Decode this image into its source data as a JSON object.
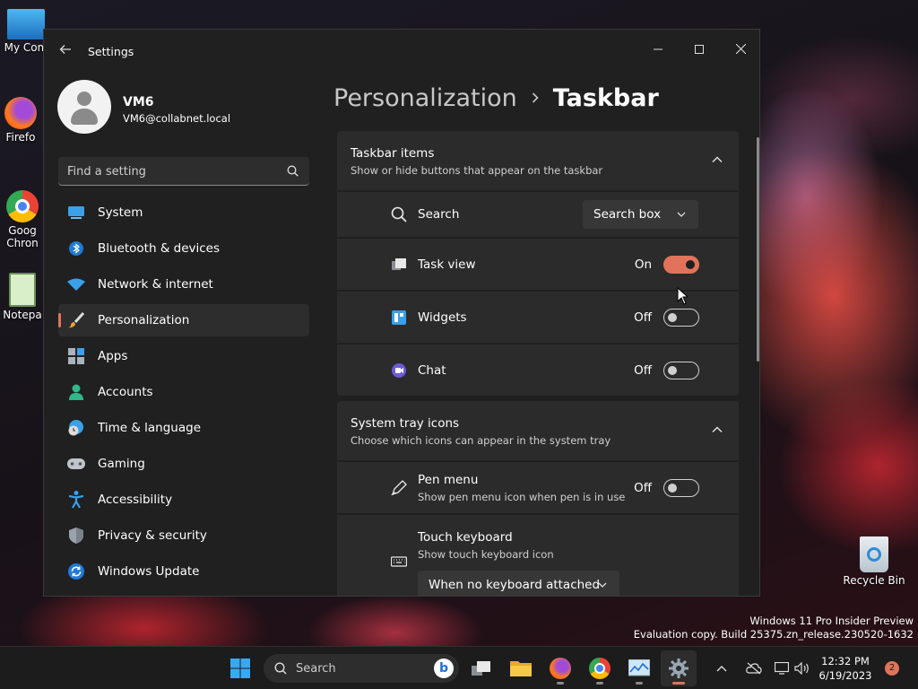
{
  "desktop": {
    "icons": [
      {
        "label": "My Com",
        "icon": "computer-icon"
      },
      {
        "label": "Firefo",
        "icon": "firefox-icon"
      },
      {
        "label": "Goog Chron",
        "icon": "chrome-icon"
      },
      {
        "label": "Notepa",
        "icon": "notepad-icon"
      },
      {
        "label": "Recycle Bin",
        "icon": "recycle-bin-icon"
      }
    ],
    "watermark": {
      "line1": "Windows 11 Pro Insider Preview",
      "line2": "Evaluation copy. Build 25375.zn_release.230520-1632"
    }
  },
  "window": {
    "app_title": "Settings",
    "accent_color": "#e0735a",
    "user": {
      "name": "VM6",
      "email": "VM6@collabnet.local"
    },
    "search": {
      "placeholder": "Find a setting"
    },
    "nav": [
      {
        "label": "System",
        "icon": "system-icon",
        "active": false
      },
      {
        "label": "Bluetooth & devices",
        "icon": "bluetooth-icon",
        "active": false
      },
      {
        "label": "Network & internet",
        "icon": "wifi-icon",
        "active": false
      },
      {
        "label": "Personalization",
        "icon": "brush-icon",
        "active": true
      },
      {
        "label": "Apps",
        "icon": "apps-icon",
        "active": false
      },
      {
        "label": "Accounts",
        "icon": "person-icon",
        "active": false
      },
      {
        "label": "Time & language",
        "icon": "globe-clock-icon",
        "active": false
      },
      {
        "label": "Gaming",
        "icon": "gamepad-icon",
        "active": false
      },
      {
        "label": "Accessibility",
        "icon": "accessibility-icon",
        "active": false
      },
      {
        "label": "Privacy & security",
        "icon": "shield-icon",
        "active": false
      },
      {
        "label": "Windows Update",
        "icon": "update-icon",
        "active": false
      }
    ],
    "breadcrumb": {
      "parent": "Personalization",
      "current": "Taskbar"
    },
    "sections": {
      "taskbar_items": {
        "title": "Taskbar items",
        "subtitle": "Show or hide buttons that appear on the taskbar",
        "rows": {
          "search": {
            "label": "Search",
            "value": "Search box"
          },
          "task_view": {
            "label": "Task view",
            "state": "On",
            "on": true
          },
          "widgets": {
            "label": "Widgets",
            "state": "Off",
            "on": false
          },
          "chat": {
            "label": "Chat",
            "state": "Off",
            "on": false
          }
        }
      },
      "system_tray": {
        "title": "System tray icons",
        "subtitle": "Choose which icons can appear in the system tray",
        "rows": {
          "pen_menu": {
            "label": "Pen menu",
            "subtitle": "Show pen menu icon when pen is in use",
            "state": "Off",
            "on": false
          },
          "touch_keyboard": {
            "label": "Touch keyboard",
            "subtitle": "Show touch keyboard icon",
            "value": "When no keyboard attached"
          }
        }
      }
    }
  },
  "taskbar": {
    "search_label": "Search",
    "clock": {
      "time": "12:32 PM",
      "date": "6/19/2023"
    },
    "notification_count": "2"
  }
}
